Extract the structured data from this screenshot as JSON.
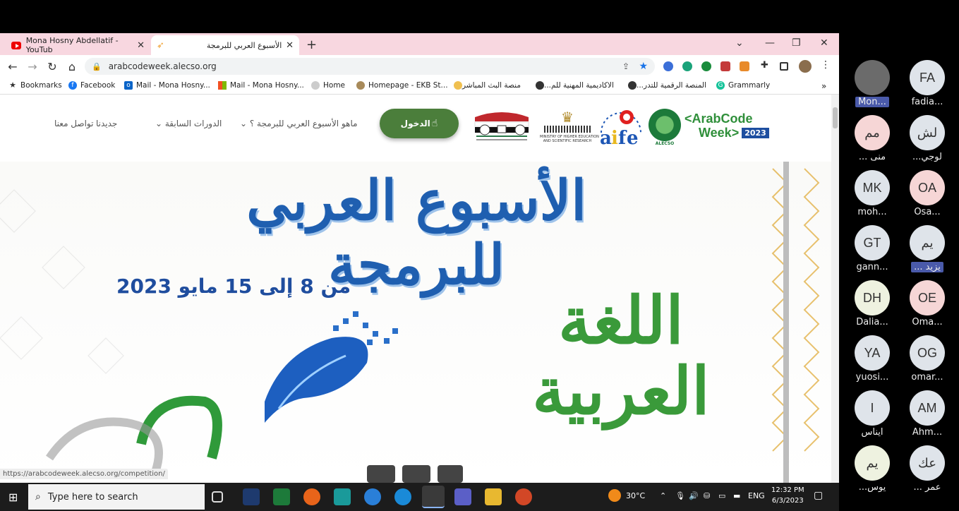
{
  "browser": {
    "tabs": [
      {
        "label": "Mona Hosny Abdellatif - YouTub"
      },
      {
        "label": "الأسبوع العربي للبرمجة"
      }
    ],
    "url": "arabcodeweek.alecso.org",
    "bookmarks": [
      "Bookmarks",
      "Facebook",
      "Mail - Mona Hosny...",
      "Mail - Mona Hosny...",
      "Home",
      "Homepage - EKB St...",
      "منصة البث المباشر",
      "الاكاديمية المهنية للم...",
      "المنصة الرقمية للتدر...",
      "Grammarly"
    ],
    "status_url": "https://arabcodeweek.alecso.org/competition/"
  },
  "site": {
    "nav": {
      "contact": "تواصل معنا",
      "news": "جديدنا",
      "past": "الدورات السابقة",
      "about": "ماهو الأسبوع العربي للبرمجة ؟",
      "login": "الدخول"
    },
    "logos": {
      "arabcode_line1": "<ArabCode",
      "arabcode_line2": "Week>",
      "arabcode_year": "2023",
      "alecso": "ALECSO",
      "ministry_line1": "MINISTRY OF HIGHER EDUCATION",
      "ministry_line2": "AND SCIENTIFIC RESEARCH"
    },
    "hero": {
      "title": "الأسبوع العربي للبرمجة",
      "date": "من 8 إلى 15 مايو 2023",
      "lang": "اللغة العربية"
    }
  },
  "participants": [
    {
      "initials": "",
      "name": "Mon...",
      "color": "#6b6b6b",
      "highlight": true
    },
    {
      "initials": "FA",
      "name": "fadia...",
      "color": "#dfe4ea",
      "highlight": false
    },
    {
      "initials": "مم",
      "name": "... منى",
      "color": "#f6d6d6",
      "highlight": false
    },
    {
      "initials": "لش",
      "name": "...لوجي",
      "color": "#dfe4ea",
      "highlight": false
    },
    {
      "initials": "MK",
      "name": "moh...",
      "color": "#dfe4ea",
      "highlight": false
    },
    {
      "initials": "OA",
      "name": "Osa...",
      "color": "#f6d6d6",
      "highlight": false
    },
    {
      "initials": "GT",
      "name": "gann...",
      "color": "#dfe4ea",
      "highlight": false
    },
    {
      "initials": "يم",
      "name": "... يزيد",
      "color": "#dfe4ea",
      "highlight": true
    },
    {
      "initials": "DH",
      "name": "Dalia...",
      "color": "#eef2e0",
      "highlight": false
    },
    {
      "initials": "OE",
      "name": "Oma...",
      "color": "#f6d6d6",
      "highlight": false
    },
    {
      "initials": "YA",
      "name": "yuosi...",
      "color": "#dfe4ea",
      "highlight": false
    },
    {
      "initials": "OG",
      "name": "omar...",
      "color": "#dfe4ea",
      "highlight": false
    },
    {
      "initials": "I",
      "name": "ايناس",
      "color": "#dfe4ea",
      "highlight": false
    },
    {
      "initials": "AM",
      "name": "Ahm...",
      "color": "#dfe4ea",
      "highlight": false
    },
    {
      "initials": "يم",
      "name": "...يوس",
      "color": "#eef2e0",
      "highlight": false
    },
    {
      "initials": "عك",
      "name": "... عمر",
      "color": "#dfe4ea",
      "highlight": false
    }
  ],
  "taskbar": {
    "search_placeholder": "Type here to search",
    "temperature": "30°C",
    "language": "ENG",
    "time": "12:32 PM",
    "date": "6/3/2023"
  }
}
